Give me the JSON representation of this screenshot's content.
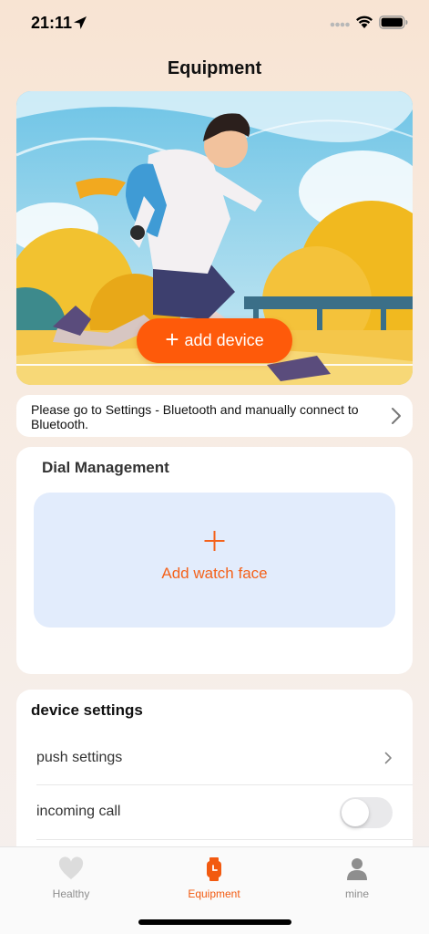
{
  "status_bar": {
    "time": "21:11"
  },
  "header": {
    "title": "Equipment"
  },
  "hero": {
    "add_device_label": "add device"
  },
  "bluetooth_notice": {
    "text": "Please go to Settings - Bluetooth and manually connect to Bluetooth."
  },
  "dial_management": {
    "title": "Dial Management",
    "add_watch_face_label": "Add watch face"
  },
  "device_settings": {
    "title": "device settings",
    "rows": [
      {
        "label": "push settings",
        "control": "chevron"
      },
      {
        "label": "incoming call",
        "control": "toggle",
        "on": false
      }
    ]
  },
  "tab_bar": {
    "tabs": [
      {
        "label": "Healthy",
        "icon": "heart-icon",
        "active": false
      },
      {
        "label": "Equipment",
        "icon": "watch-icon",
        "active": true
      },
      {
        "label": "mine",
        "icon": "person-icon",
        "active": false
      }
    ]
  },
  "colors": {
    "accent": "#fe5a0a",
    "tab_active": "#f25a10",
    "watch_face_bg": "#e2ecfc"
  }
}
